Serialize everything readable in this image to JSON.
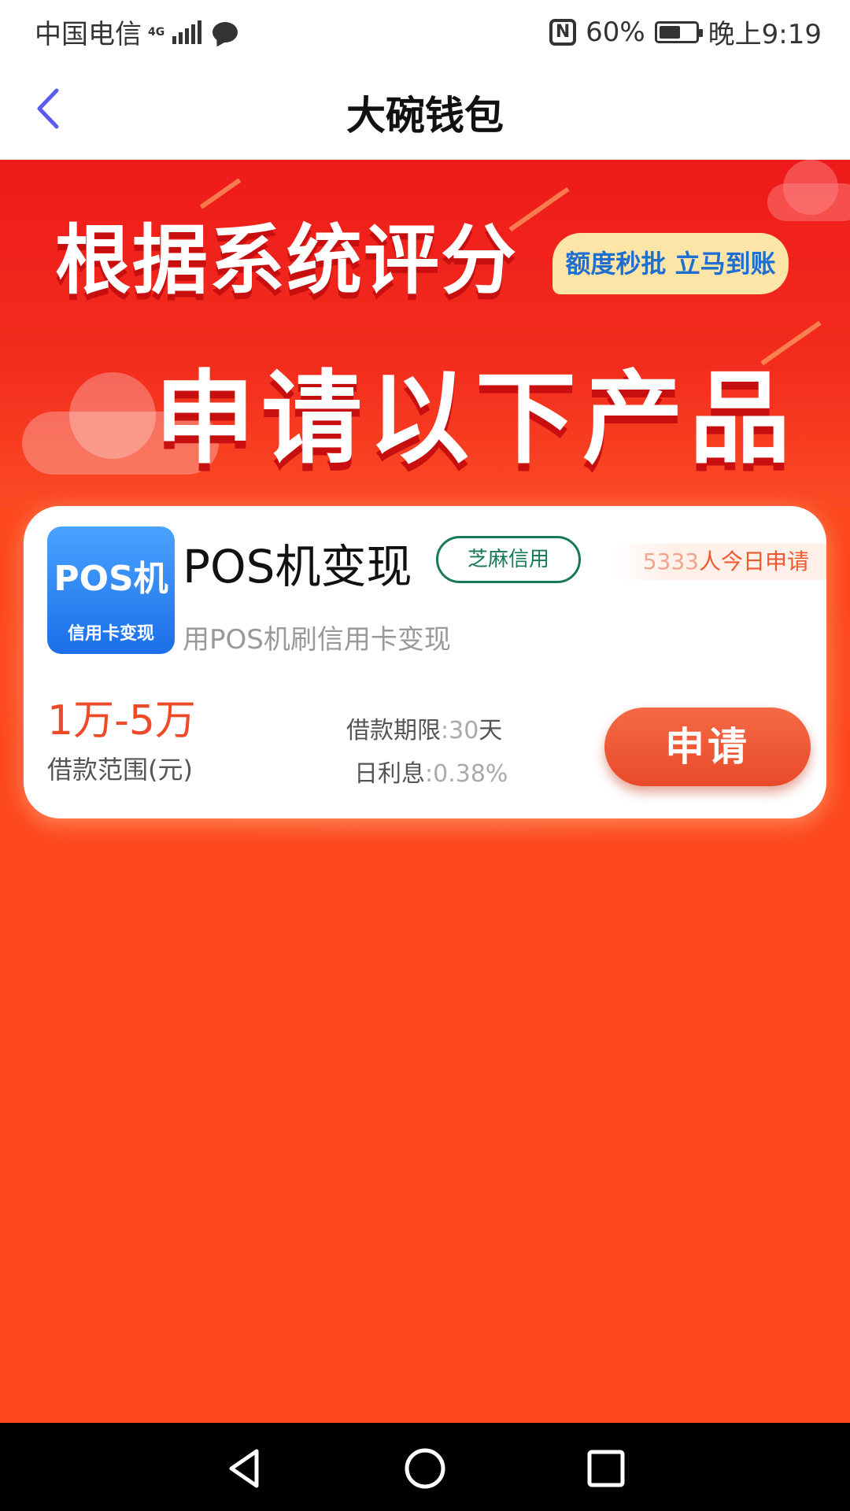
{
  "status_bar": {
    "carrier": "中国电信",
    "network": "4G",
    "nfc": "N",
    "battery_text": "60%",
    "battery_level": 0.6,
    "time": "晚上9:19"
  },
  "header": {
    "title": "大碗钱包",
    "back_icon": "chevron-left-icon",
    "accent_color": "#5b5bf0"
  },
  "banner": {
    "line1": "根据系统评分",
    "tag": "额度秒批 立马到账",
    "line2": "申请以下产品"
  },
  "product": {
    "logo_title": "POS机",
    "logo_subtitle": "信用卡变现",
    "name": "POS机变现",
    "credit_tag": "芝麻信用",
    "applicants_count": "5333",
    "applicants_suffix": "人今日申请",
    "description": "用POS机刷信用卡变现",
    "loan_range": "1万-5万",
    "loan_range_label": "借款范围(元)",
    "term_label": "借款期限",
    "term_value": ":30",
    "term_unit": "天",
    "rate_label": "日利息",
    "rate_value": ":0.38%",
    "apply_label": "申请"
  },
  "nav_bar": {
    "back": "triangle-back-icon",
    "home": "circle-home-icon",
    "recent": "square-recent-icon"
  },
  "colors": {
    "banner_red": "#ee1a1a",
    "page_orange": "#fd481e",
    "button_orange": "#e84a2a",
    "credit_green": "#177a55",
    "logo_blue": "#1b6fe8"
  }
}
